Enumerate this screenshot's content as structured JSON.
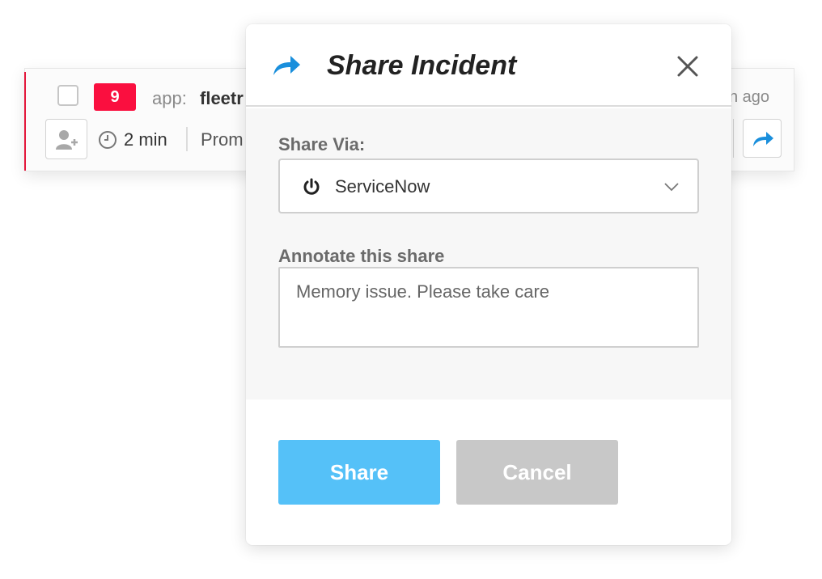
{
  "incident_card": {
    "severity": "9",
    "app_label": "app:",
    "app_name": "fleetr",
    "time_ago": "n ago",
    "duration": "2 min",
    "source": "Prom"
  },
  "modal": {
    "title": "Share Incident",
    "share_via_label": "Share Via:",
    "share_via_value": "ServiceNow",
    "annotate_label": "Annotate this share",
    "annotation_value": "Memory issue. Please take care",
    "share_button": "Share",
    "cancel_button": "Cancel"
  },
  "icons": {
    "header": "share-arrow-icon",
    "close": "close-icon",
    "integration": "power-icon",
    "dropdown": "chevron-down-icon",
    "assign": "add-user-icon",
    "duration": "clock-icon",
    "card_share": "share-arrow-icon"
  },
  "colors": {
    "severity_badge": "#fa0f3f",
    "share_button": "#55c1f8",
    "cancel_button": "#c8c8c8",
    "share_icon": "#1a8fdc"
  }
}
